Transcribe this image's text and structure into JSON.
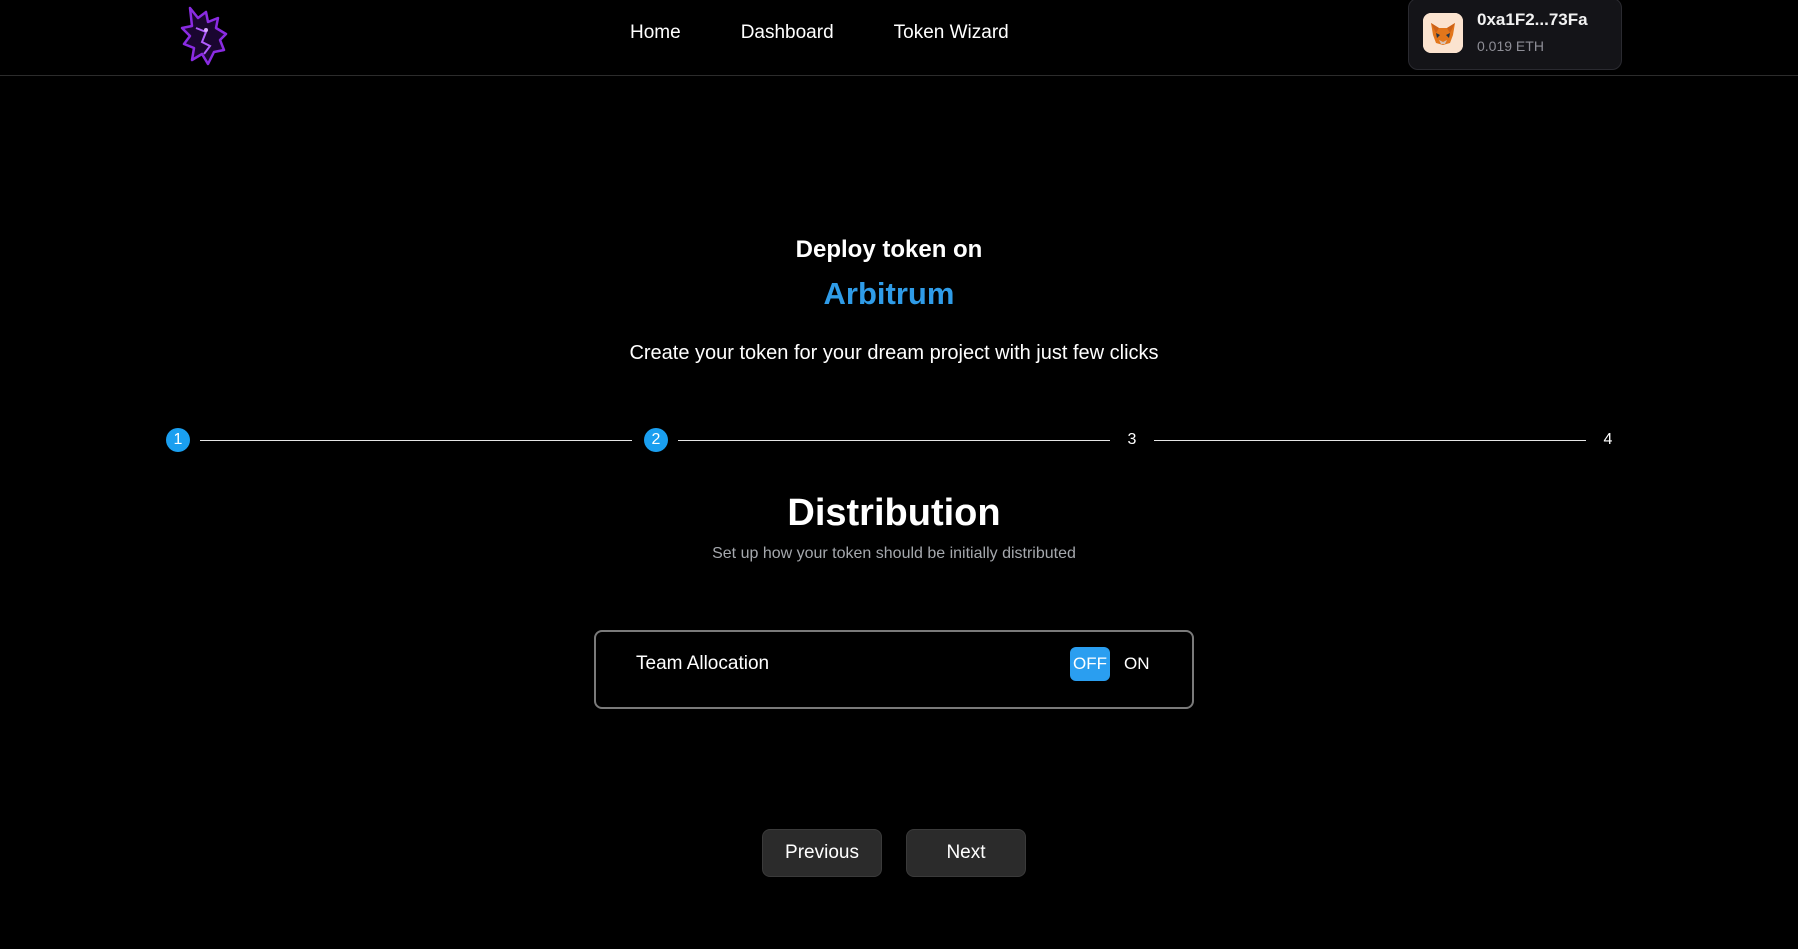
{
  "header": {
    "nav": [
      "Home",
      "Dashboard",
      "Token Wizard"
    ],
    "wallet": {
      "address": "0xa1F2...73Fa",
      "balance": "0.019 ETH"
    }
  },
  "hero": {
    "title": "Deploy token on",
    "chain": "Arbitrum",
    "subtitle": "Create your token for your dream project with just few clicks"
  },
  "stepper": {
    "steps": [
      "1",
      "2",
      "3",
      "4"
    ],
    "current_step": 2
  },
  "section": {
    "title": "Distribution",
    "subtitle": "Set up how your token should be initially distributed"
  },
  "team_allocation": {
    "label": "Team Allocation",
    "off_label": "OFF",
    "on_label": "ON",
    "selected": "OFF"
  },
  "buttons": {
    "previous": "Previous",
    "next": "Next"
  },
  "colors": {
    "accent": "#2f9ce8",
    "step_active": "#1a9ff0",
    "background": "#000000"
  }
}
